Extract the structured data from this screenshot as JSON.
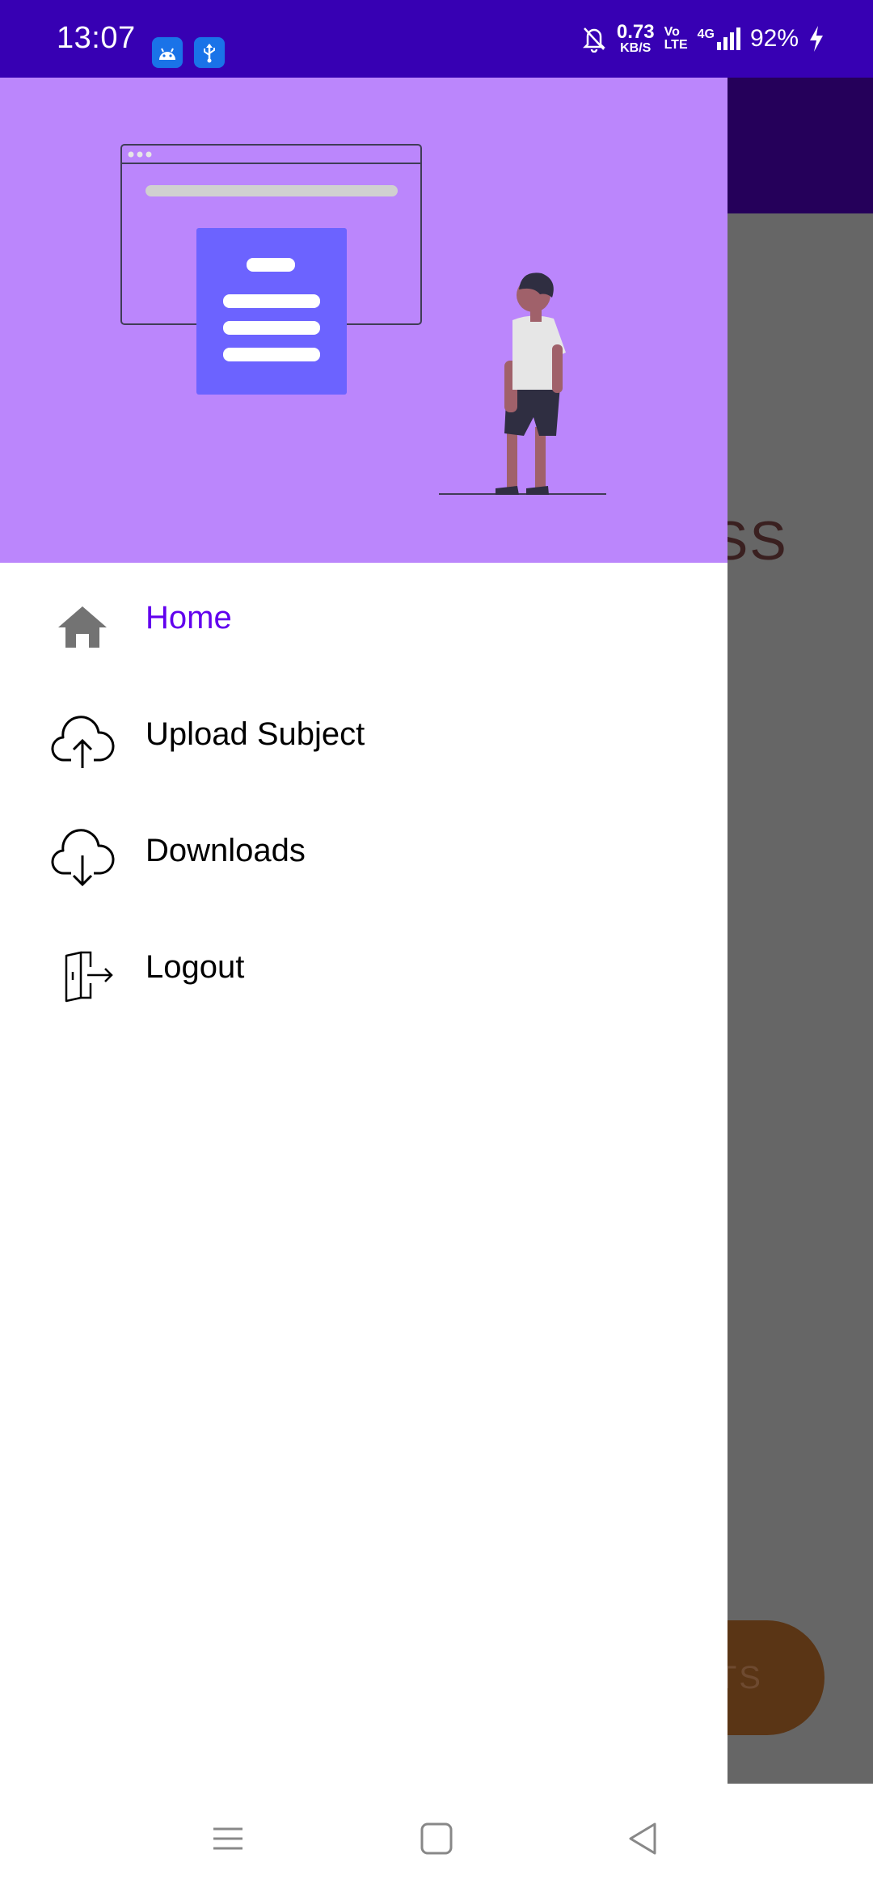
{
  "status_bar": {
    "time": "13:07",
    "net_speed_value": "0.73",
    "net_speed_unit": "KB/S",
    "volte_top": "Vo",
    "volte_bottom": "LTE",
    "network": "4G",
    "battery": "92%",
    "icons": [
      "android-debug-icon",
      "usb-icon",
      "bell-off-icon",
      "signal-icon",
      "charging-icon"
    ]
  },
  "background": {
    "partial_text": "SS",
    "fab_partial_label": "TS",
    "fab_color": "#5a3515"
  },
  "drawer": {
    "header_color": "#bb86fc",
    "accent_color": "#6200ee",
    "items": [
      {
        "label": "Home",
        "icon": "home-icon",
        "active": true
      },
      {
        "label": "Upload Subject",
        "icon": "cloud-upload-icon",
        "active": false
      },
      {
        "label": "Downloads",
        "icon": "cloud-download-icon",
        "active": false
      },
      {
        "label": "Logout",
        "icon": "logout-icon",
        "active": false
      }
    ]
  },
  "nav_bar": {
    "buttons": [
      "menu-button",
      "home-button",
      "back-button"
    ]
  }
}
